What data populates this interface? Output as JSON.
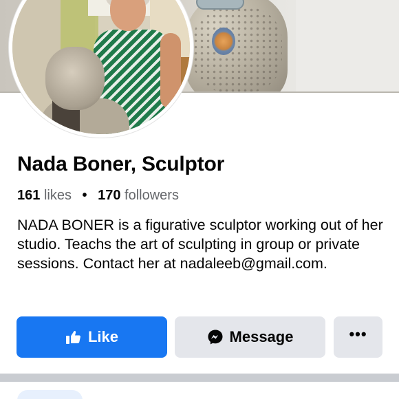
{
  "profile": {
    "name": "Nada Boner, Sculptor",
    "likes_count": "161",
    "likes_label": "likes",
    "separator": "•",
    "followers_count": "170",
    "followers_label": "followers",
    "bio": "NADA BONER is a figurative sculptor working out of her studio. Teachs the art of sculpting in group or private sessions. Contact her at nadaleeb@gmail.com."
  },
  "actions": {
    "like_label": "Like",
    "like_icon": "thumbs-up-icon",
    "message_label": "Message",
    "message_icon": "messenger-icon",
    "more_label": "•••",
    "more_icon": "more-options-icon"
  },
  "colors": {
    "primary": "#1877f2",
    "secondary_button": "#e4e6eb",
    "text": "#050505",
    "muted_text": "#65676b",
    "divider": "#c9ccd1"
  }
}
